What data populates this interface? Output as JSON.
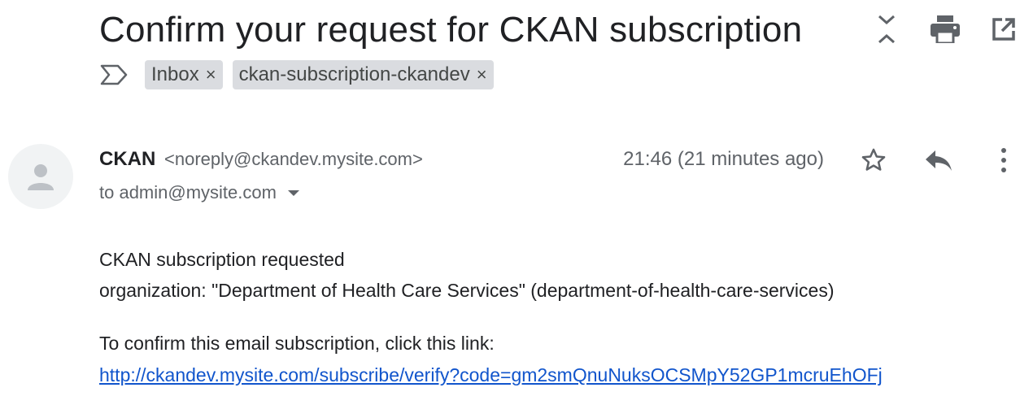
{
  "email": {
    "subject": "Confirm your request for CKAN subscription",
    "labels": [
      {
        "name": "Inbox",
        "remove": "×"
      },
      {
        "name": "ckan-subscription-ckandev",
        "remove": "×"
      }
    ],
    "sender_name": "CKAN",
    "sender_email": "<noreply@ckandev.mysite.com>",
    "recipient": "to admin@mysite.com",
    "timestamp": "21:46 (21 minutes ago)",
    "body": {
      "line1": "CKAN subscription requested",
      "line2": "organization: \"Department of Health Care Services\" (department-of-health-care-services)",
      "line3": "To confirm this email subscription, click this link:",
      "link": "http://ckandev.mysite.com/subscribe/verify?code=gm2smQnuNuksOCSMpY52GP1mcruEhOFj"
    }
  },
  "icons": {
    "expand": "expand-collapse-icon",
    "print": "print-icon",
    "open": "open-in-new-window-icon",
    "important": "important-marker-icon",
    "star": "star-icon",
    "reply": "reply-icon",
    "more": "more-vert-icon",
    "avatar": "person-icon"
  },
  "colors": {
    "chip_bg": "#dadce0",
    "link": "#1155cc",
    "secondary_text": "#5f6368"
  }
}
